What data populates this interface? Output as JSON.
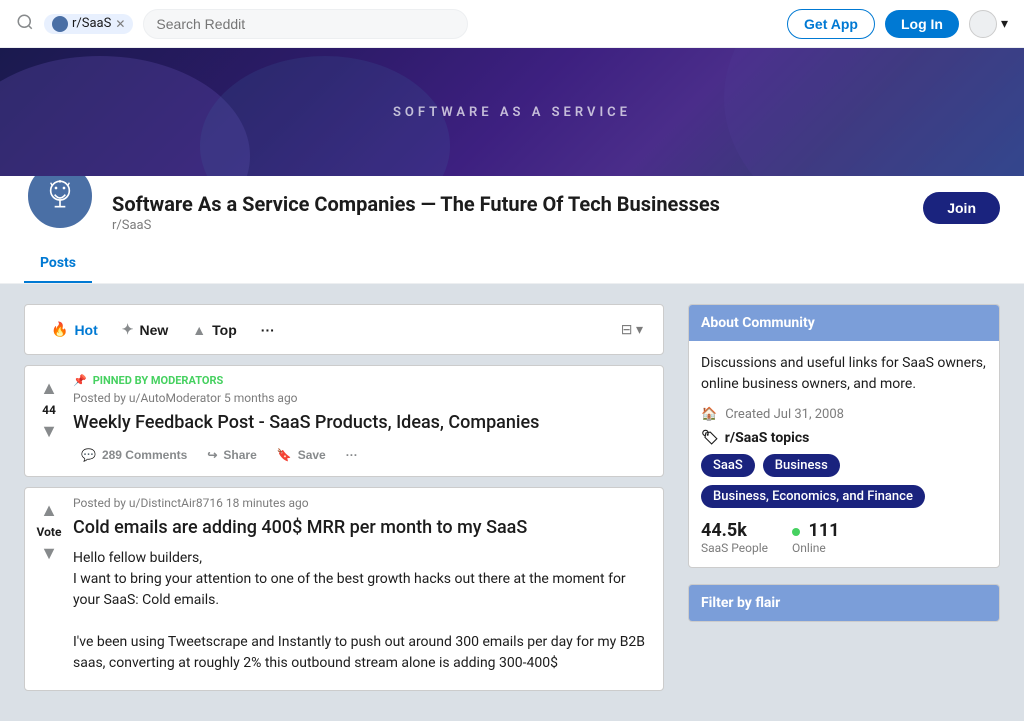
{
  "topnav": {
    "subreddit_pill": "r/SaaS",
    "search_placeholder": "Search Reddit",
    "get_app_label": "Get App",
    "login_label": "Log In"
  },
  "banner": {
    "text": "SOFTWARE AS A SERVICE"
  },
  "sub_header": {
    "title": "Software As a Service Companies — The Future Of Tech Businesses",
    "sub_name": "r/SaaS",
    "join_label": "Join"
  },
  "tabs": [
    {
      "label": "Posts",
      "active": true
    }
  ],
  "sort_bar": {
    "hot_label": "Hot",
    "new_label": "New",
    "top_label": "Top",
    "more_label": "···"
  },
  "posts": [
    {
      "pinned": true,
      "pinned_label": "PINNED BY MODERATORS",
      "meta": "Posted by u/AutoModerator 5 months ago",
      "title": "Weekly Feedback Post - SaaS Products, Ideas, Companies",
      "votes": "44",
      "comments_label": "289 Comments",
      "share_label": "Share",
      "save_label": "Save",
      "more_label": "···"
    },
    {
      "pinned": false,
      "meta": "Posted by u/DistinctAir8716 18 minutes ago",
      "title": "Cold emails are adding 400$ MRR per month to my SaaS",
      "vote_label": "Vote",
      "body_line1": "Hello fellow builders,",
      "body_line2": "I want to bring your attention to one of the best growth hacks out there at the moment for your SaaS: Cold emails.",
      "body_line3": "I've been using Tweetscrape and Instantly to push out around 300 emails per day for my B2B saas, converting at roughly 2% this outbound stream alone is adding 300-400$"
    }
  ],
  "sidebar": {
    "about_header": "About Community",
    "about_desc": "Discussions and useful links for SaaS owners, online business owners, and more.",
    "created_label": "Created Jul 31, 2008",
    "topics_prefix": "r/SaaS topics",
    "tags": [
      "SaaS",
      "Business",
      "Business, Economics, and Finance"
    ],
    "stats": {
      "members_num": "44.5k",
      "members_label": "SaaS People",
      "online_num": "111",
      "online_label": "Online"
    },
    "filter_header": "Filter by flair"
  }
}
